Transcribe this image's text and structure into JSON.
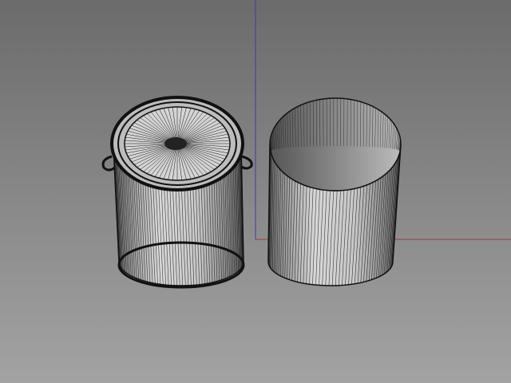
{
  "viewport": {
    "background_top": "#6b6b6b",
    "background_bottom": "#a3a3a3",
    "axis_y_color": "#3a3aa8",
    "axis_x_color": "#b83030",
    "shade_light": "#dcdcdc",
    "shade_dark": "#5c5c5c",
    "wire_color": "#111111"
  },
  "objects": [
    "paint-can",
    "cylinder"
  ]
}
